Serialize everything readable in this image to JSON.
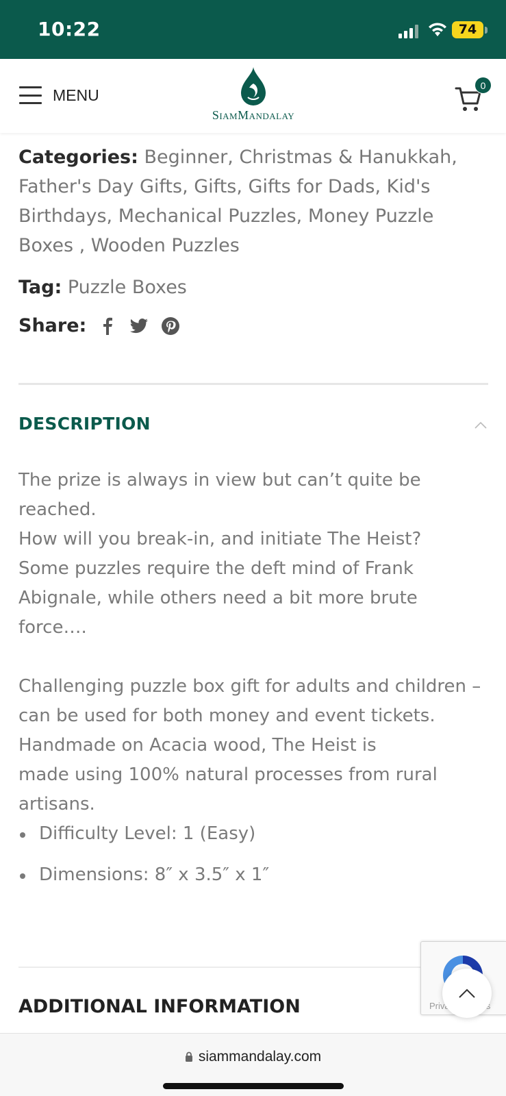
{
  "status_bar": {
    "time": "10:22",
    "battery": "74",
    "bg_color": "#0b5a4c"
  },
  "header": {
    "menu_label": "MENU",
    "logo_text": "SiamMandalay",
    "cart_count": "0",
    "brand_color": "#0b5a4c"
  },
  "product_meta": {
    "categories_label": "Categories:",
    "categories_text": "Beginner, Christmas & Hanukkah, Father's Day Gifts, Gifts, Gifts for Dads, Kid's Birthdays, Mechanical Puzzles, Money Puzzle Boxes , Wooden Puzzles",
    "tag_label": "Tag:",
    "tag_value": "Puzzle Boxes",
    "share_label": "Share:",
    "share_icons": [
      "facebook-icon",
      "twitter-icon",
      "pinterest-icon"
    ]
  },
  "description": {
    "title": "DESCRIPTION",
    "paragraph_1": "The prize is always in view but can’t quite be reached.",
    "paragraph_2": "How will you break-in, and initiate The Heist?",
    "paragraph_3": "Some puzzles require the deft mind of Frank Abignale, while others need a bit more brute force….",
    "paragraph_4": "Challenging puzzle box gift for adults and children – can be used for both money and event tickets.",
    "paragraph_5": "Handmade on Acacia wood, The Heist is",
    "paragraph_6": "made using 100% natural processes from rural artisans.",
    "bullets": [
      "Difficulty Level: 1 (Easy)",
      "Dimensions: 8″ x 3.5″ x 1″"
    ]
  },
  "additional_info": {
    "title": "ADDITIONAL INFORMATION"
  },
  "recaptcha": {
    "text": "Privacy - Terms"
  },
  "browser": {
    "url": "siammandalay.com"
  }
}
